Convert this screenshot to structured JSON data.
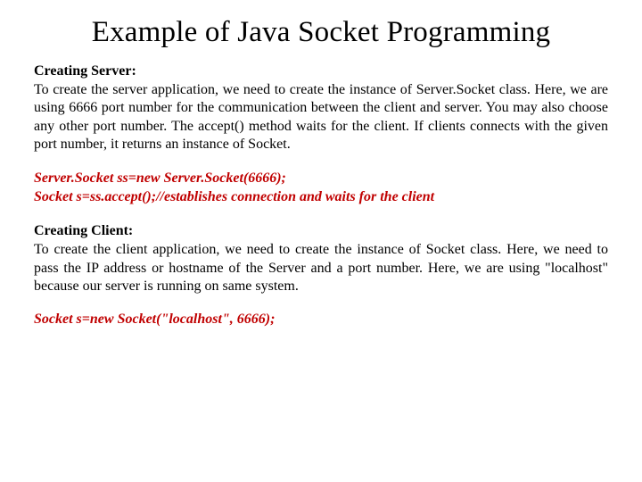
{
  "title": "Example of Java Socket Programming",
  "server": {
    "heading": "Creating Server:",
    "body": "To create the server application, we need to create the instance of Server.Socket class. Here, we are using 6666 port number for the communication between the client and server. You may also choose any other port number. The accept() method waits for the client. If clients connects with the given port number, it returns an instance of Socket.",
    "code": [
      "Server.Socket ss=new Server.Socket(6666);",
      "Socket s=ss.accept();//establishes connection and waits for the client"
    ]
  },
  "client": {
    "heading": "Creating Client:",
    "body": "To create the client application, we need to create the instance of Socket class. Here, we need to pass the IP address or hostname of the Server and a port number. Here, we are using \"localhost\" because our server is running on same system.",
    "code": [
      "Socket s=new Socket(\"localhost\", 6666);"
    ]
  }
}
